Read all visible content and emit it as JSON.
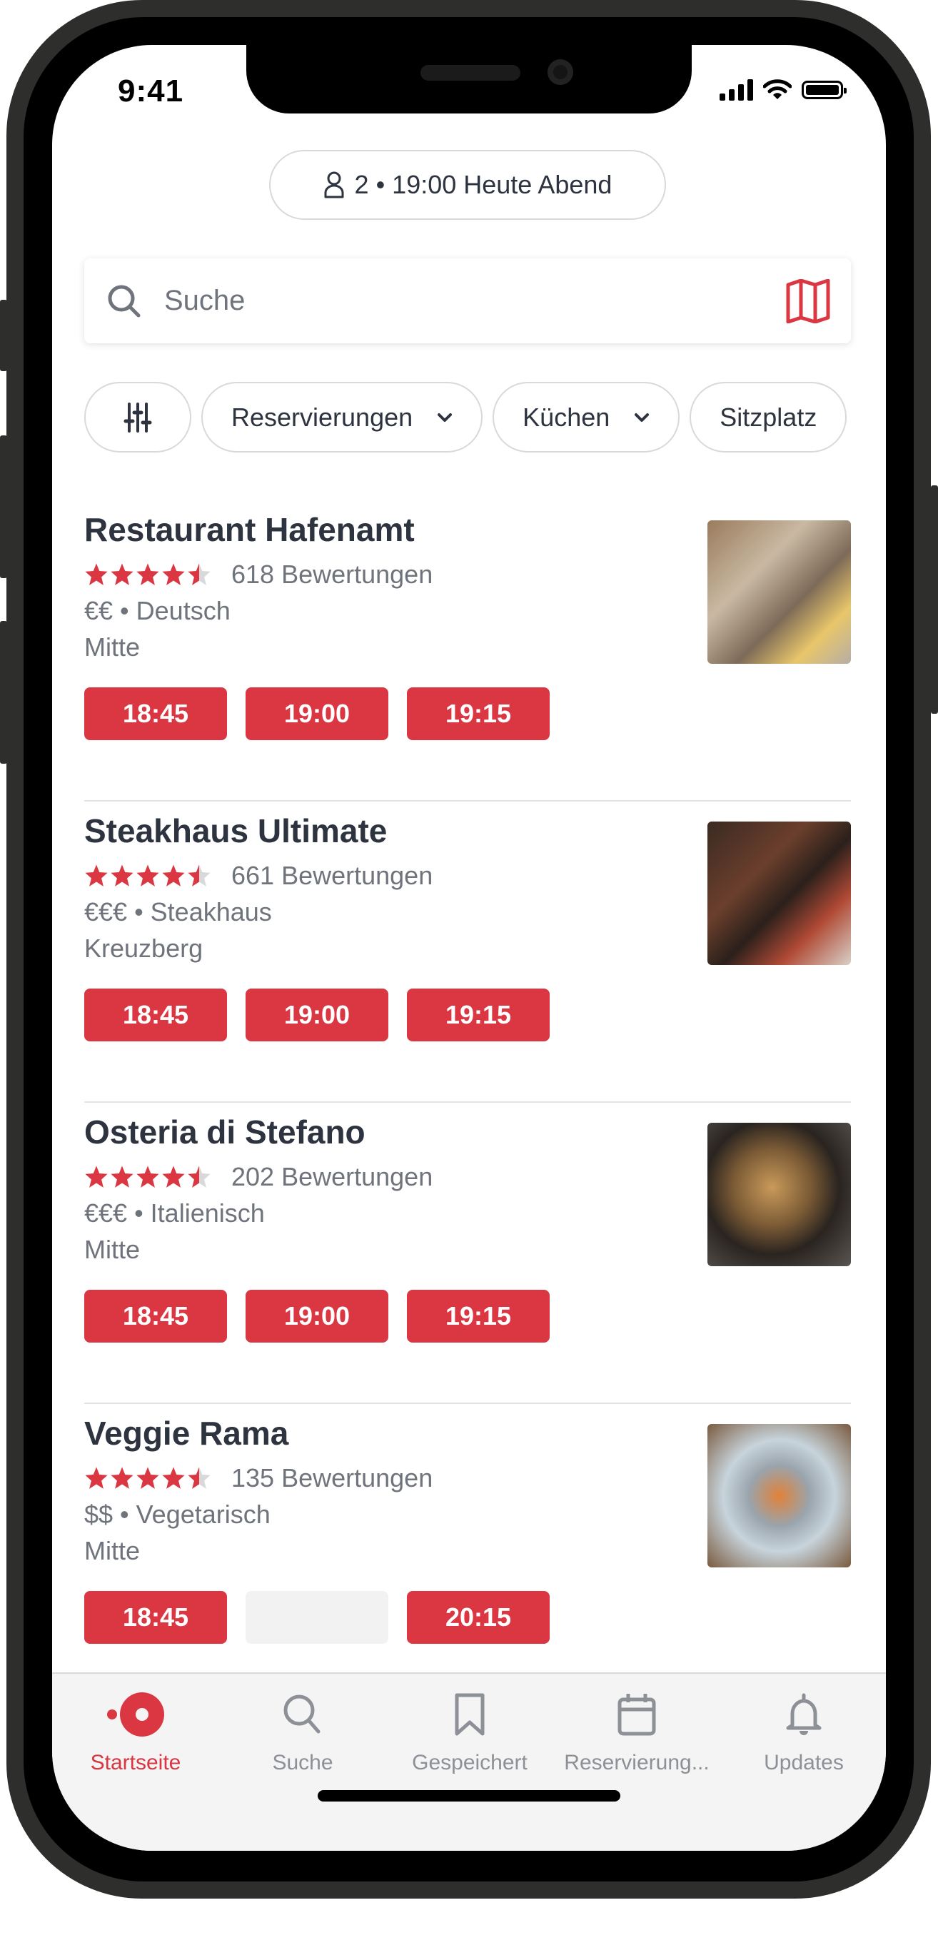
{
  "status_bar": {
    "time": "9:41"
  },
  "party_pill": {
    "icon": "person-icon",
    "label": "2 • 19:00 Heute Abend"
  },
  "search": {
    "placeholder": "Suche",
    "value": "",
    "search_icon": "search-icon",
    "map_icon": "map-icon"
  },
  "filters": [
    {
      "icon": "sliders-icon",
      "label": ""
    },
    {
      "label": "Reservierungen",
      "icon": "chevron-down-icon"
    },
    {
      "label": "Küchen",
      "icon": "chevron-down-icon"
    },
    {
      "label": "Sitzplatz"
    }
  ],
  "accent_color": "#da3743",
  "restaurants": [
    {
      "name": "Restaurant Hafenamt",
      "rating": 4.5,
      "reviews": "618 Bewertungen",
      "price_cuisine": "€€ • Deutsch",
      "area": "Mitte",
      "slots": [
        "18:45",
        "19:00",
        "19:15"
      ],
      "image": "food-photo-german"
    },
    {
      "name": "Steakhaus Ultimate",
      "rating": 4.5,
      "reviews": "661 Bewertungen",
      "price_cuisine": "€€€ • Steakhaus",
      "area": "Kreuzberg",
      "slots": [
        "18:45",
        "19:00",
        "19:15"
      ],
      "image": "food-photo-steak"
    },
    {
      "name": "Osteria di Stefano",
      "rating": 4.5,
      "reviews": "202 Bewertungen",
      "price_cuisine": "€€€ • Italienisch",
      "area": "Mitte",
      "slots": [
        "18:45",
        "19:00",
        "19:15"
      ],
      "image": "food-photo-pasta"
    },
    {
      "name": "Veggie Rama",
      "rating": 4.5,
      "reviews": "135 Bewertungen",
      "price_cuisine": "$$ • Vegetarisch",
      "area": "Mitte",
      "slots": [
        "18:45",
        "",
        "20:15"
      ],
      "image": "food-photo-vegetarian"
    }
  ],
  "tabbar": [
    {
      "label": "Startseite",
      "icon": "home-icon",
      "active": true
    },
    {
      "label": "Suche",
      "icon": "search-icon",
      "active": false
    },
    {
      "label": "Gespeichert",
      "icon": "bookmark-icon",
      "active": false
    },
    {
      "label": "Reservierung...",
      "icon": "calendar-icon",
      "active": false
    },
    {
      "label": "Updates",
      "icon": "bell-icon",
      "active": false
    }
  ]
}
